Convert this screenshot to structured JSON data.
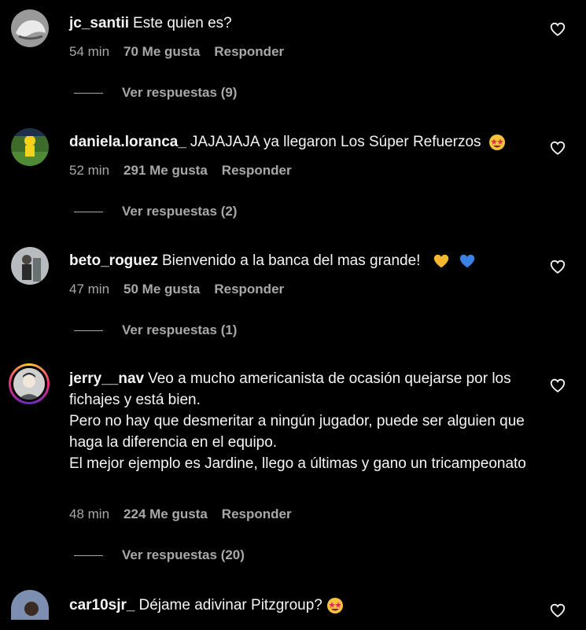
{
  "comments": [
    {
      "username": "jc_santii",
      "text": "Este quien es?",
      "time": "54 min",
      "likes": "70 Me gusta",
      "reply_label": "Responder",
      "replies_label": "Ver respuestas (9)"
    },
    {
      "username": "daniela.loranca_",
      "text": "JAJAJAJA ya llegaron Los Súper Refuerzos",
      "time": "52 min",
      "likes": "291 Me gusta",
      "reply_label": "Responder",
      "replies_label": "Ver respuestas (2)"
    },
    {
      "username": "beto_roguez",
      "text": "Bienvenido a la banca del mas grande!",
      "time": "47 min",
      "likes": "50 Me gusta",
      "reply_label": "Responder",
      "replies_label": "Ver respuestas (1)"
    },
    {
      "username": "jerry__nav",
      "text": "Veo a mucho americanista de ocasión quejarse por los fichajes y está bien.",
      "text_lines": [
        "Pero no hay que desmeritar a ningún jugador, puede ser alguien que haga la diferencia en el equipo.",
        "El mejor ejemplo es Jardine, llego a últimas y gano un tricampeonato"
      ],
      "time": "48 min",
      "likes": "224 Me gusta",
      "reply_label": "Responder",
      "replies_label": "Ver respuestas (20)"
    },
    {
      "username": "car10sjr_",
      "text": "Déjame adivinar Pitzgroup?"
    }
  ],
  "icons": {
    "like": "heart-outline-icon",
    "star_eyes": "star-struck-emoji",
    "yellow_heart": "yellow-heart-emoji",
    "blue_heart": "blue-heart-emoji"
  },
  "colors": {
    "background": "#000000",
    "text": "#f5f5f5",
    "secondary": "#a8a8a8"
  }
}
